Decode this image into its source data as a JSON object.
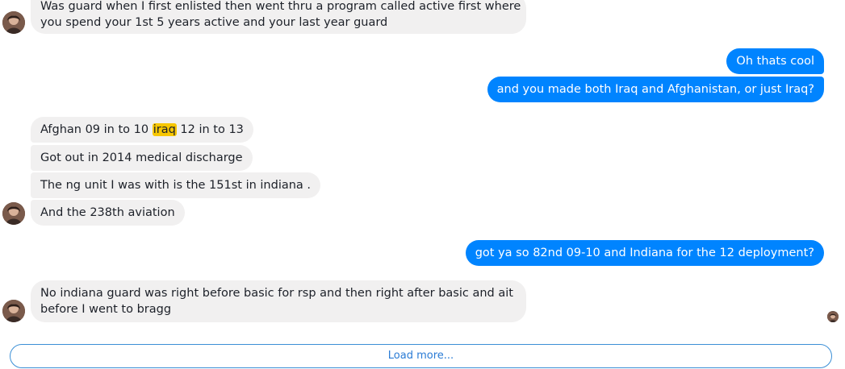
{
  "conversation": {
    "messages": {
      "m0": {
        "line1": "Was guard when I first enlisted then went thru a program called active first where",
        "line2": "you spend your 1st 5 years active and your last year guard"
      },
      "m1": "Oh thats cool",
      "m2": "and you made both Iraq and Afghanistan, or just Iraq?",
      "m3": {
        "before": "Afghan 09 in to 10 ",
        "highlight": "iraq",
        "after": " 12 in to 13"
      },
      "m4": "Got out in 2014 medical discharge",
      "m5": "The ng unit I was with is the 151st in indiana .",
      "m6": "And the 238th aviation",
      "m7": "got ya so 82nd 09-10 and Indiana for the 12 deployment?",
      "m8": {
        "line1": "No indiana guard was right before basic for rsp and then right after basic and ait",
        "line2": "before I went to bragg"
      }
    }
  },
  "load_more": {
    "label": "Load more..."
  },
  "colors": {
    "outgoing_bubble": "#0084ff",
    "incoming_bubble": "#f1f0f0",
    "search_highlight": "#f7c600",
    "load_more_accent": "#2a7bd5"
  }
}
